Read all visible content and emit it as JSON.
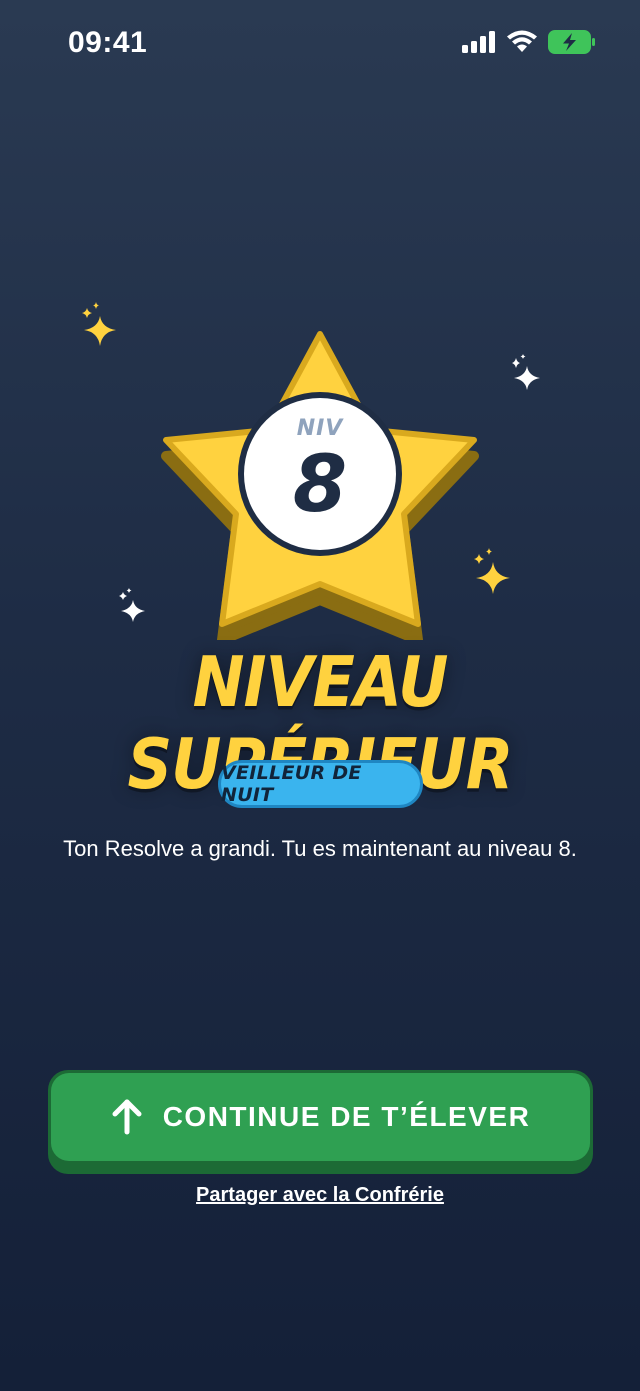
{
  "status_bar": {
    "time": "09:41"
  },
  "level_badge": {
    "prefix": "NIV",
    "number": "8"
  },
  "headline": "NIVEAU SUPÉRIEUR",
  "rank_title": "VEILLEUR DE NUIT",
  "message": "Ton Resolve a grandi. Tu es maintenant au niveau 8.",
  "primary_button": {
    "label": "CONTINUE DE T’ÉLEVER",
    "icon": "arrow-up-icon"
  },
  "secondary_link": "Partager avec la Confrérie",
  "colors": {
    "background_top": "#2a3a52",
    "background_bottom": "#142038",
    "gold": "#ffd23f",
    "badge_blue": "#3ab4ee",
    "button_green": "#2fa052"
  }
}
